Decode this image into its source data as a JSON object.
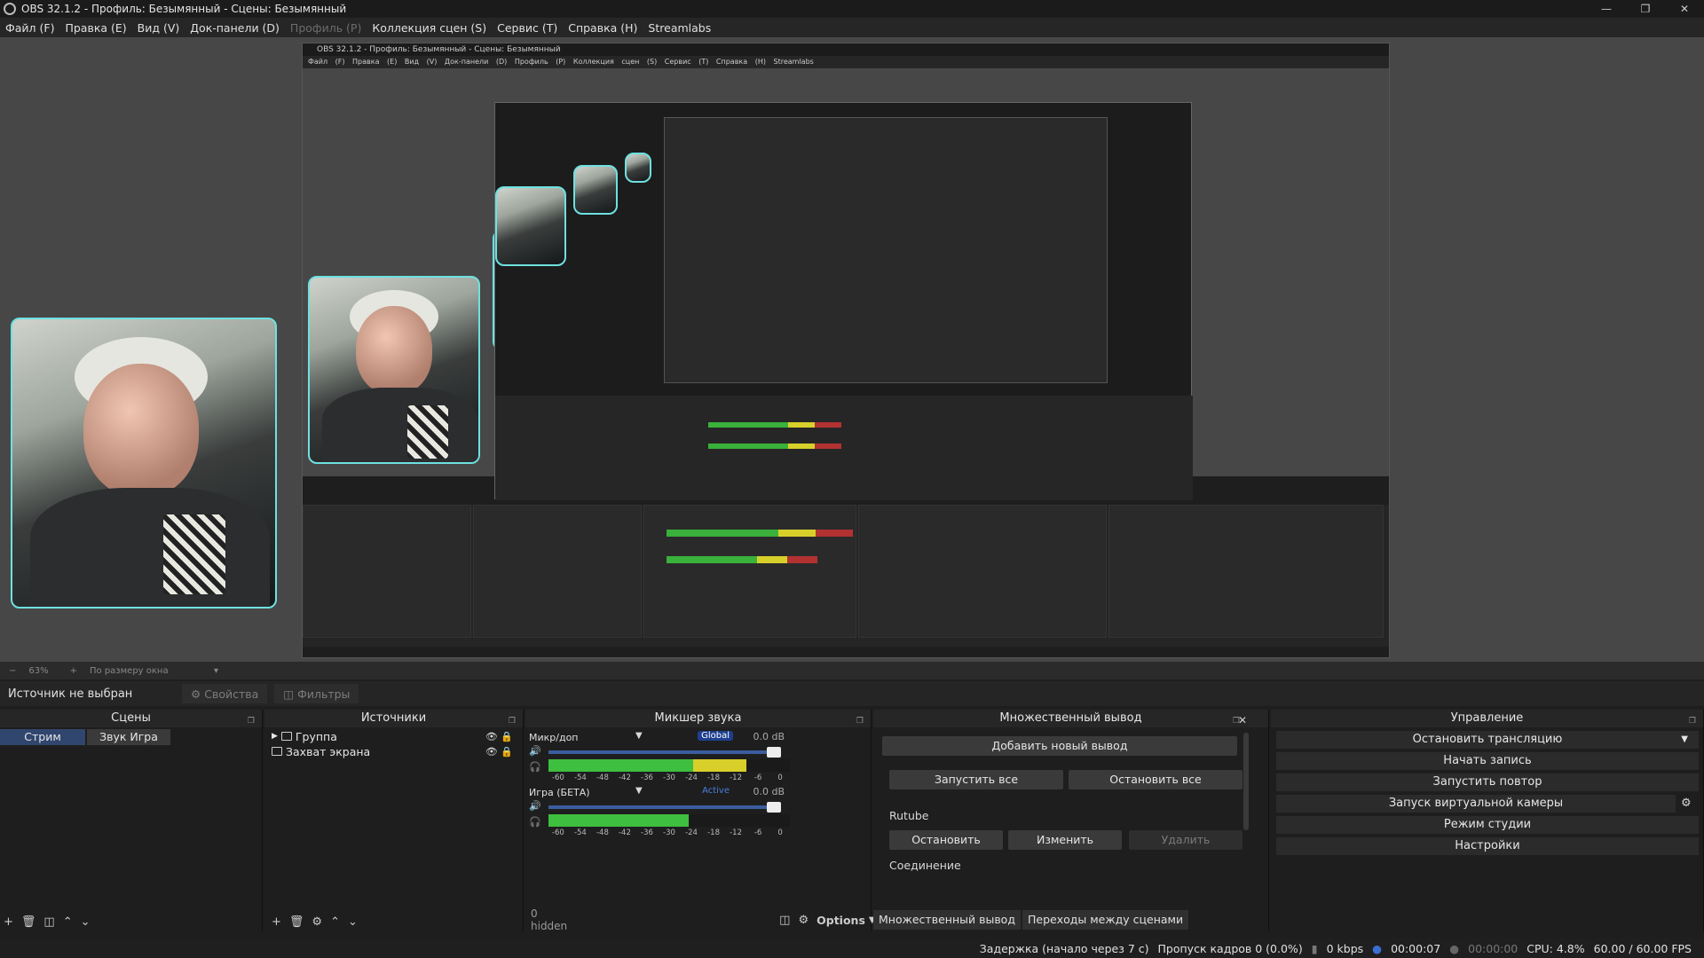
{
  "window": {
    "title": "OBS 32.1.2 - Профиль: Безымянный - Сцены: Безымянный"
  },
  "menu": [
    {
      "label": "Файл (F)",
      "disabled": false
    },
    {
      "label": "Правка (E)",
      "disabled": false
    },
    {
      "label": "Вид (V)",
      "disabled": false
    },
    {
      "label": "Док-панели (D)",
      "disabled": false
    },
    {
      "label": "Профиль (P)",
      "disabled": true
    },
    {
      "label": "Коллекция сцен (S)",
      "disabled": false
    },
    {
      "label": "Сервис (T)",
      "disabled": false
    },
    {
      "label": "Справка (H)",
      "disabled": false
    },
    {
      "label": "Streamlabs",
      "disabled": false
    }
  ],
  "zoom": {
    "value": "63%",
    "mode": "По размеру окна"
  },
  "source_bar": {
    "no_source": "Источник не выбран",
    "properties": "Свойства",
    "filters": "Фильтры"
  },
  "scenes": {
    "title": "Сцены",
    "items": [
      "Стрим",
      "Звук Игра"
    ]
  },
  "sources": {
    "title": "Источники",
    "items": [
      "Группа",
      "Захват экрана"
    ]
  },
  "mixer": {
    "title": "Микшер звука",
    "channels": [
      {
        "name": "Микр/доп",
        "badge": "Global",
        "db": "0.0 dB",
        "level": 0.82
      },
      {
        "name": "Игра (БЕТА)",
        "badge": "Active",
        "db": "0.0 dB",
        "level": 0.58
      }
    ],
    "scale": [
      "-60",
      "-54",
      "-48",
      "-42",
      "-36",
      "-30",
      "-24",
      "-18",
      "-12",
      "-6",
      "0"
    ],
    "hidden": "0 hidden",
    "options": "Options"
  },
  "multiout": {
    "title": "Множественный вывод",
    "add": "Добавить новый вывод",
    "start_all": "Запустить все",
    "stop_all": "Остановить все",
    "service": "Rutube",
    "stop": "Остановить",
    "edit": "Изменить",
    "delete": "Удалить",
    "connection": "Соединение"
  },
  "dock_tabs": [
    "Множественный вывод",
    "Переходы между сценами"
  ],
  "controls": {
    "title": "Управление",
    "items": [
      "Остановить трансляцию",
      "Начать запись",
      "Запустить повтор",
      "Запуск виртуальной камеры",
      "Режим студии",
      "Настройки"
    ]
  },
  "status": {
    "delay": "Задержка (начало через 7 с)",
    "dropped": "Пропуск кадров 0 (0.0%)",
    "kbps": "0 kbps",
    "live_time": "00:00:07",
    "rec_time": "00:00:00",
    "cpu": "CPU: 4.8%",
    "fps": "60.00 / 60.00 FPS"
  }
}
